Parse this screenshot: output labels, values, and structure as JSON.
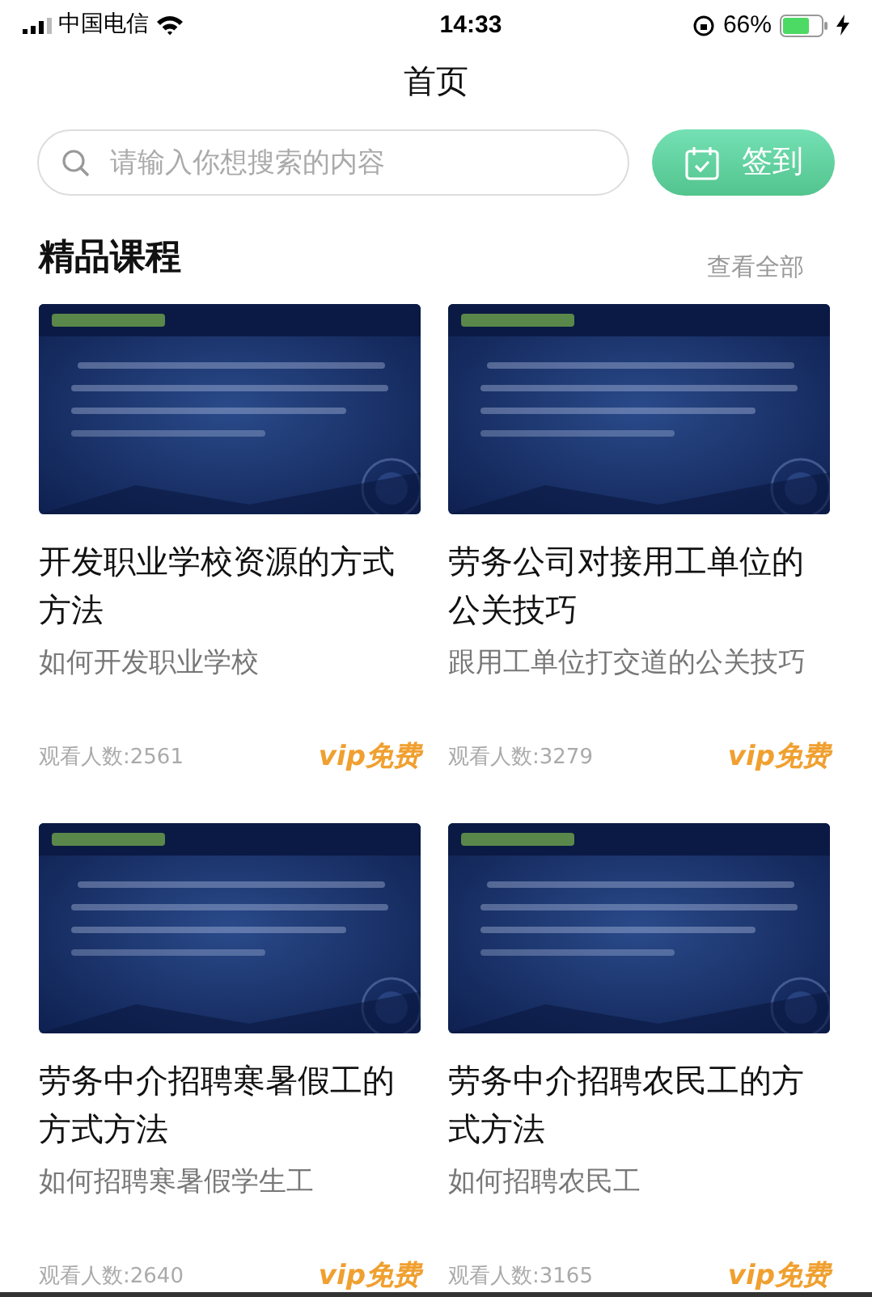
{
  "status_bar": {
    "carrier": "中国电信",
    "time": "14:33",
    "battery": "66%"
  },
  "nav": {
    "title": "首页"
  },
  "search": {
    "placeholder": "请输入你想搜索的内容"
  },
  "checkin_button": {
    "label": "签到"
  },
  "section": {
    "title": "精品课程",
    "more": "查看全部"
  },
  "courses": [
    {
      "title": "开发职业学校资源的方式方法",
      "subtitle": "如何开发职业学校",
      "views": "观看人数:2561",
      "badge": "vip免费"
    },
    {
      "title": "劳务公司对接用工单位的公关技巧",
      "subtitle": "跟用工单位打交道的公关技巧",
      "views": "观看人数:3279",
      "badge": "vip免费"
    },
    {
      "title": "劳务中介招聘寒暑假工的方式方法",
      "subtitle": "如何招聘寒暑假学生工",
      "views": "观看人数:2640",
      "badge": "vip免费"
    },
    {
      "title": "劳务中介招聘农民工的方式方法",
      "subtitle": "如何招聘农民工",
      "views": "观看人数:3165",
      "badge": "vip免费"
    }
  ]
}
